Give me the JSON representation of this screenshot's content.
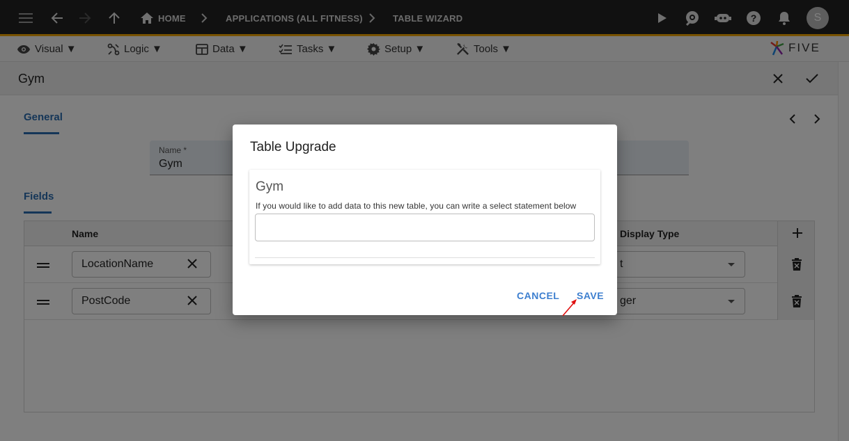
{
  "topbar": {
    "breadcrumbs": [
      "HOME",
      "APPLICATIONS (ALL FITNESS)",
      "TABLE WIZARD"
    ],
    "avatar_letter": "S",
    "icons": [
      "menu-icon",
      "back-icon",
      "forward-icon",
      "up-icon",
      "home-icon",
      "play-icon",
      "search-chat-icon",
      "bot-icon",
      "help-icon",
      "bell-icon"
    ]
  },
  "menubar": {
    "items": [
      "Visual ▼",
      "Logic ▼",
      "Data ▼",
      "Tasks ▼",
      "Setup ▼",
      "Tools ▼"
    ],
    "logo_text": "FIVE"
  },
  "form": {
    "title": "Gym",
    "tab_general": "General",
    "name_label": "Name *",
    "name_value": "Gym",
    "tab_fields": "Fields"
  },
  "grid": {
    "col_name": "Name",
    "col_display_type": "Display Type",
    "rows": [
      {
        "name": "LocationName",
        "display_type": "t"
      },
      {
        "name": "PostCode",
        "display_type": "ger"
      }
    ]
  },
  "dialog": {
    "title": "Table Upgrade",
    "card_title": "Gym",
    "card_desc": "If you would like to add data to this new table, you can write a select statement below",
    "input_value": "",
    "cancel_label": "CANCEL",
    "save_label": "SAVE"
  },
  "colors": {
    "topbar": "#222222",
    "accent_line": "#f0a400",
    "link_blue": "#3d7fcf",
    "arrow_red": "#e01010"
  }
}
